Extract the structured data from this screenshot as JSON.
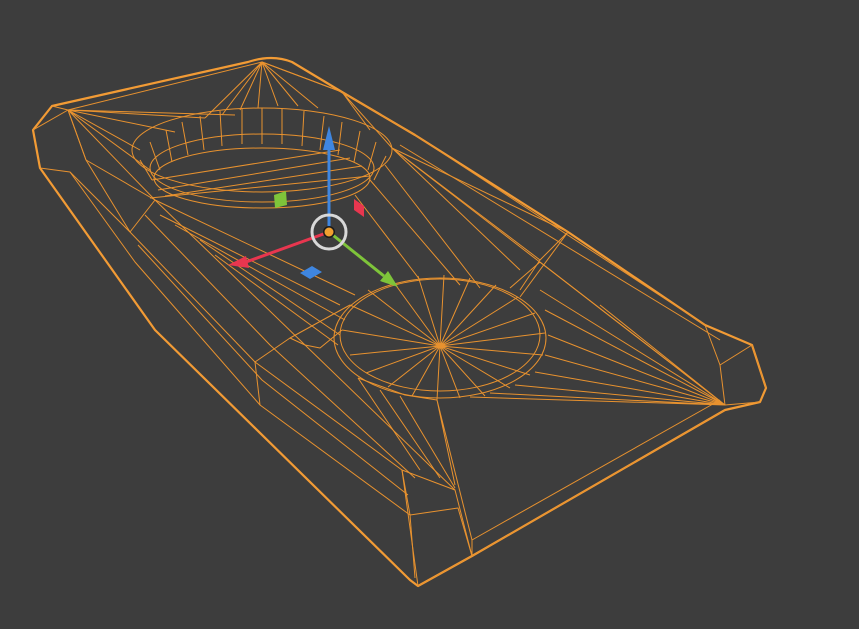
{
  "viewport": {
    "background": "#3d3d3d"
  },
  "mesh": {
    "selected": true,
    "wire_color": "#e8922f",
    "outline_color": "#f29b35"
  },
  "gizmo": {
    "type": "move",
    "x_axis_color": "#e8364f",
    "y_axis_color": "#7ec43a",
    "z_axis_color": "#3f86e0",
    "center_color": "#f0a030",
    "ring_color": "#d8d8d8",
    "plane_handles": [
      "xy-plane",
      "yz-plane",
      "xz-plane"
    ]
  }
}
